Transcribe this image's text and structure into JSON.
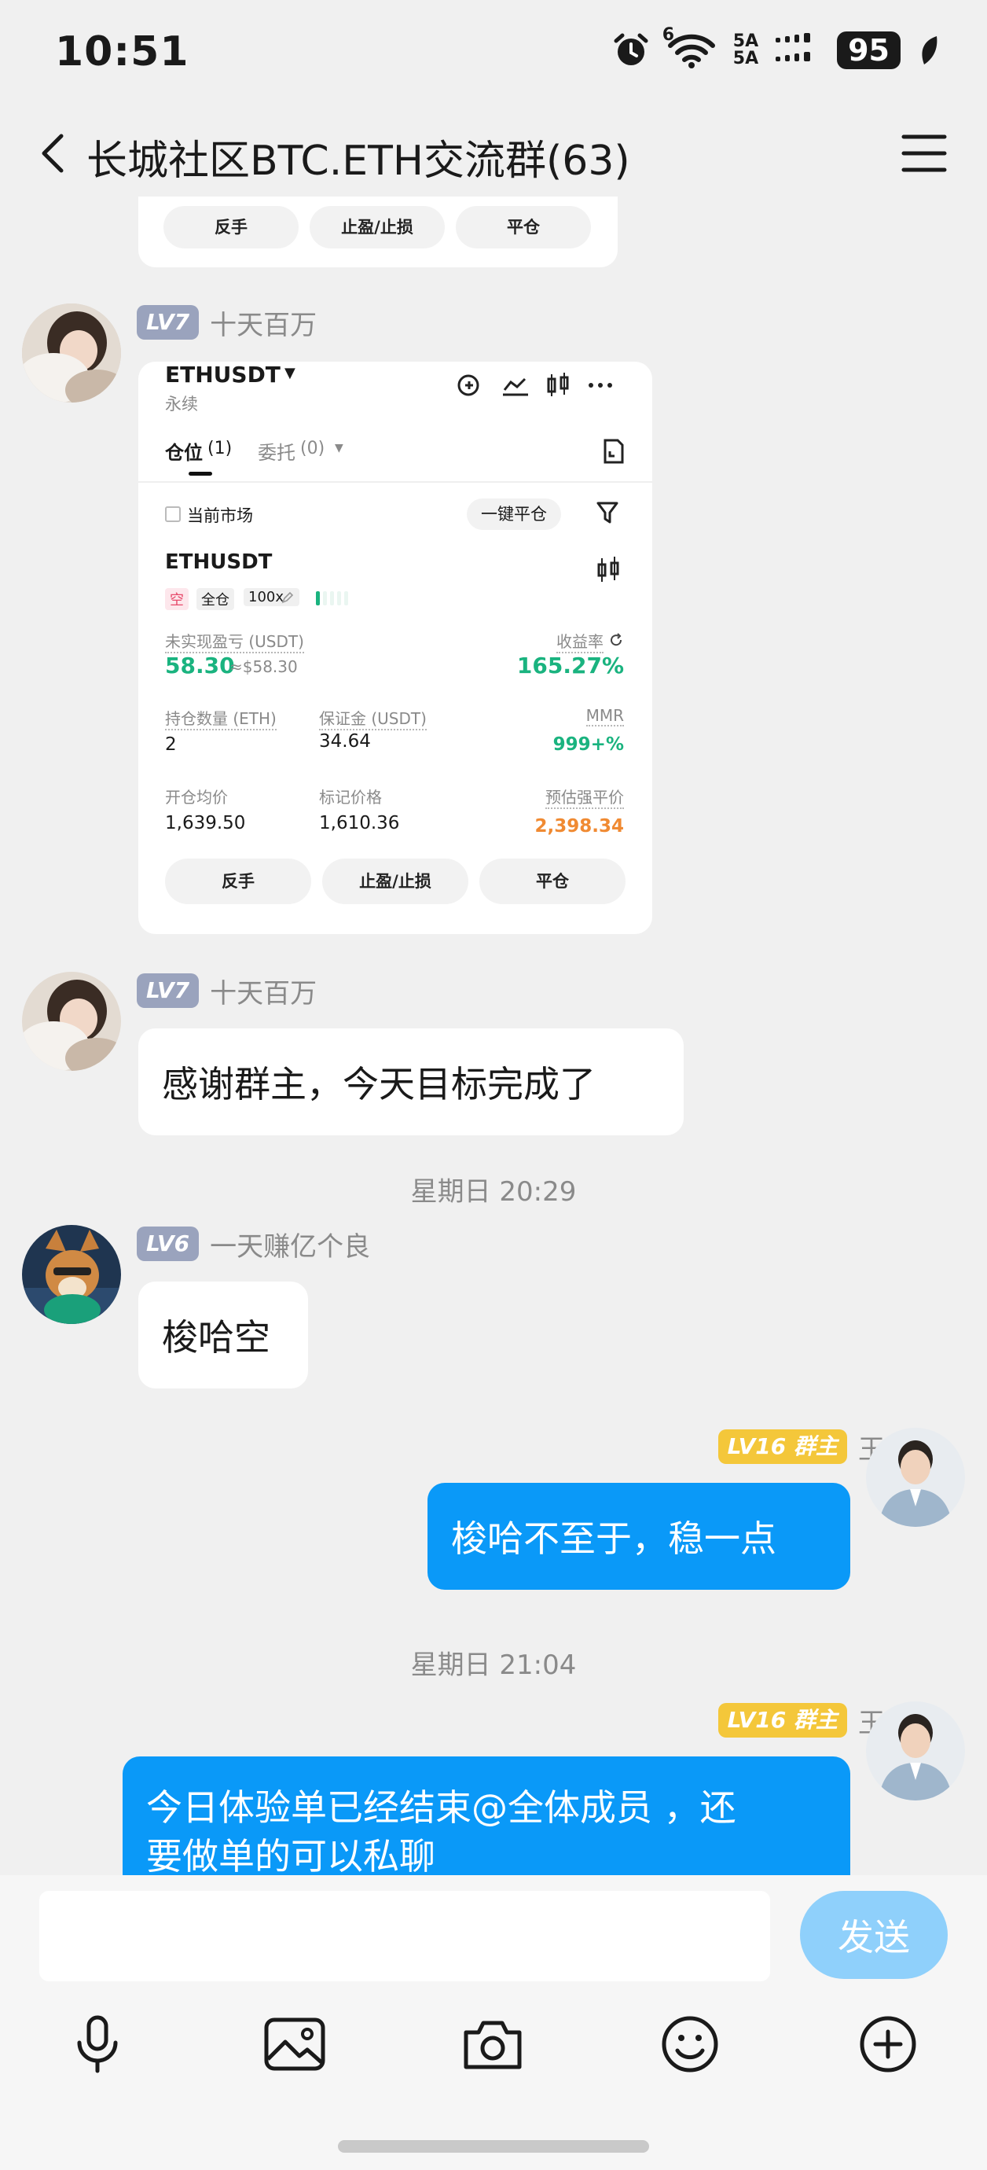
{
  "status_bar": {
    "time": "10:51",
    "network_badge": "6",
    "net_top": "5A",
    "net_bottom": "5A",
    "battery": "95"
  },
  "header": {
    "title": "长城社区BTC.ETH交流群(63)"
  },
  "prev_card": {
    "btn_reverse": "反手",
    "btn_tpsl": "止盈/止损",
    "btn_close": "平仓"
  },
  "messages": {
    "m1": {
      "level": "LV7",
      "name": "十天百万",
      "shot": {
        "symbol": "ETHUSDT",
        "symbol_sub": "永续",
        "tab_positions": "仓位",
        "tab_positions_count": "(1)",
        "tab_orders": "委托",
        "tab_orders_count": "(0)",
        "filter_label": "当前市场",
        "close_all": "一键平仓",
        "pos_symbol": "ETHUSDT",
        "tag_side": "空",
        "tag_margin": "全仓",
        "tag_leverage": "100x",
        "pnl_label": "未实现盈亏 (USDT)",
        "pnl_value": "58.30",
        "pnl_approx": "≈$58.30",
        "roe_label": "收益率",
        "roe_value": "165.27%",
        "size_label": "持仓数量 (ETH)",
        "size_value": "2",
        "margin_label": "保证金 (USDT)",
        "margin_value": "34.64",
        "mmr_label": "MMR",
        "mmr_value": "999+%",
        "entry_label": "开仓均价",
        "entry_value": "1,639.50",
        "mark_label": "标记价格",
        "mark_value": "1,610.36",
        "liq_label": "预估强平价",
        "liq_value": "2,398.34",
        "btn_reverse": "反手",
        "btn_tpsl": "止盈/止损",
        "btn_close": "平仓"
      }
    },
    "m2": {
      "level": "LV7",
      "name": "十天百万",
      "text": "感谢群主，今天目标完成了"
    },
    "ts1": "星期日 20:29",
    "m3": {
      "level": "LV6",
      "name": "一天赚亿个良",
      "text": "梭哈空"
    },
    "m4": {
      "level": "LV16 群主",
      "name": "王",
      "text": "梭哈不至于，稳一点"
    },
    "ts2": "星期日 21:04",
    "m5": {
      "level": "LV16 群主",
      "name": "王",
      "text_line1": "今日体验单已经结束@全体成员 ，还",
      "text_line2": "要做单的可以私聊"
    }
  },
  "input": {
    "value": "",
    "placeholder": "",
    "send": "发送"
  },
  "icons": [
    "alarm-icon",
    "wifi-icon",
    "back-icon",
    "menu-icon",
    "mic-icon",
    "image-icon",
    "camera-icon",
    "emoji-icon",
    "plus-icon"
  ],
  "colors": {
    "outgoing_bubble": "#0a99f8",
    "send_button": "#8fd0fb",
    "profit_green": "#1ab37f",
    "liq_orange": "#f08a32",
    "level_badge": "#9aa3bd",
    "owner_badge": "#f4c73a"
  }
}
